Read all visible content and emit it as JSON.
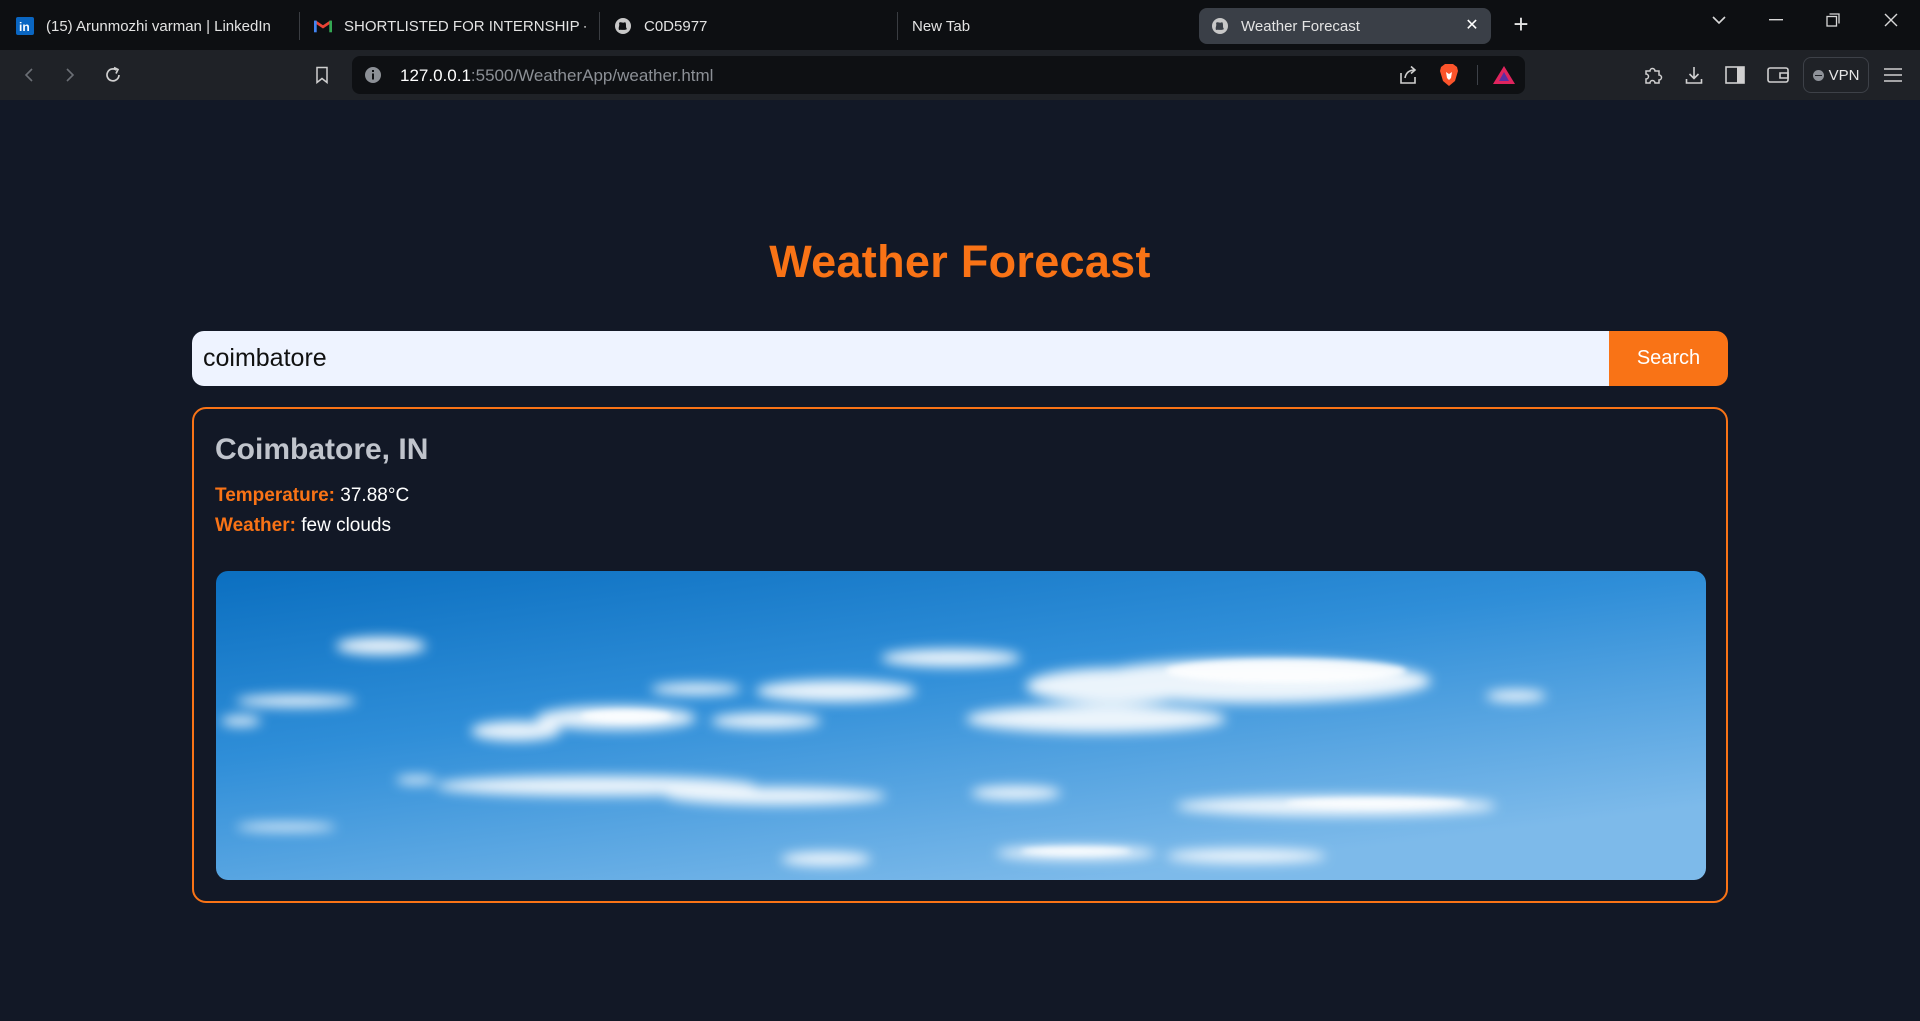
{
  "browser": {
    "tabs": [
      {
        "title": "(15) Arunmozhi varman | LinkedIn",
        "icon": "linkedin-icon"
      },
      {
        "title": "SHORTLISTED FOR INTERNSHIP - am",
        "icon": "gmail-icon"
      },
      {
        "title": "C0D5977",
        "icon": "globe-icon"
      },
      {
        "title": "New Tab",
        "icon": ""
      },
      {
        "title": "Weather Forecast",
        "icon": "globe-icon",
        "active": true
      }
    ],
    "url_host": "127.0.0.1",
    "url_rest": ":5500/WeatherApp/weather.html",
    "vpn_label": "VPN"
  },
  "app": {
    "title": "Weather Forecast",
    "search_value": "coimbatore",
    "search_button": "Search",
    "result": {
      "city": "Coimbatore, IN",
      "temperature_label": "Temperature:",
      "temperature_value": "37.88°C",
      "weather_label": "Weather:",
      "weather_value": "few clouds"
    }
  },
  "colors": {
    "accent": "#f97316",
    "page_bg": "#121826",
    "input_bg": "#eef3ff"
  }
}
